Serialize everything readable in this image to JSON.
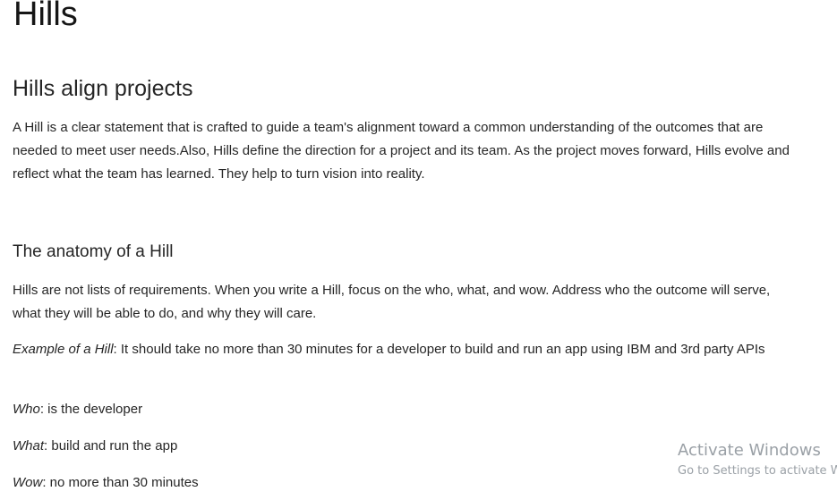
{
  "article": {
    "title": "Hills",
    "section1": {
      "heading": "Hills align projects",
      "paragraph": "A Hill is a clear statement that is crafted to guide a team's alignment toward a common understanding of the outcomes that are needed to meet user needs.Also, Hills define the direction for a project and its team. As the project moves forward, Hills evolve and reflect what the team has learned. They help to turn vision into reality."
    },
    "section2": {
      "heading": "The anatomy of a Hill",
      "paragraph": "Hills are not lists of requirements. When you write a Hill, focus on the who, what, and wow. Address who the outcome will serve, what they will be able to do, and why they will care.",
      "example_label": "Example of a Hill",
      "example_text": ": It should take no more than 30 minutes for a developer to build and run an app using IBM and 3rd party APIs",
      "who_label": "Who",
      "who_text": ": is the developer",
      "what_label": "What",
      "what_text": ": build and run the app",
      "wow_label": "Wow",
      "wow_text": ": no more than 30 minutes"
    }
  },
  "watermark": {
    "line1": "Activate Windows",
    "line2": "Go to Settings to activate Windows."
  }
}
